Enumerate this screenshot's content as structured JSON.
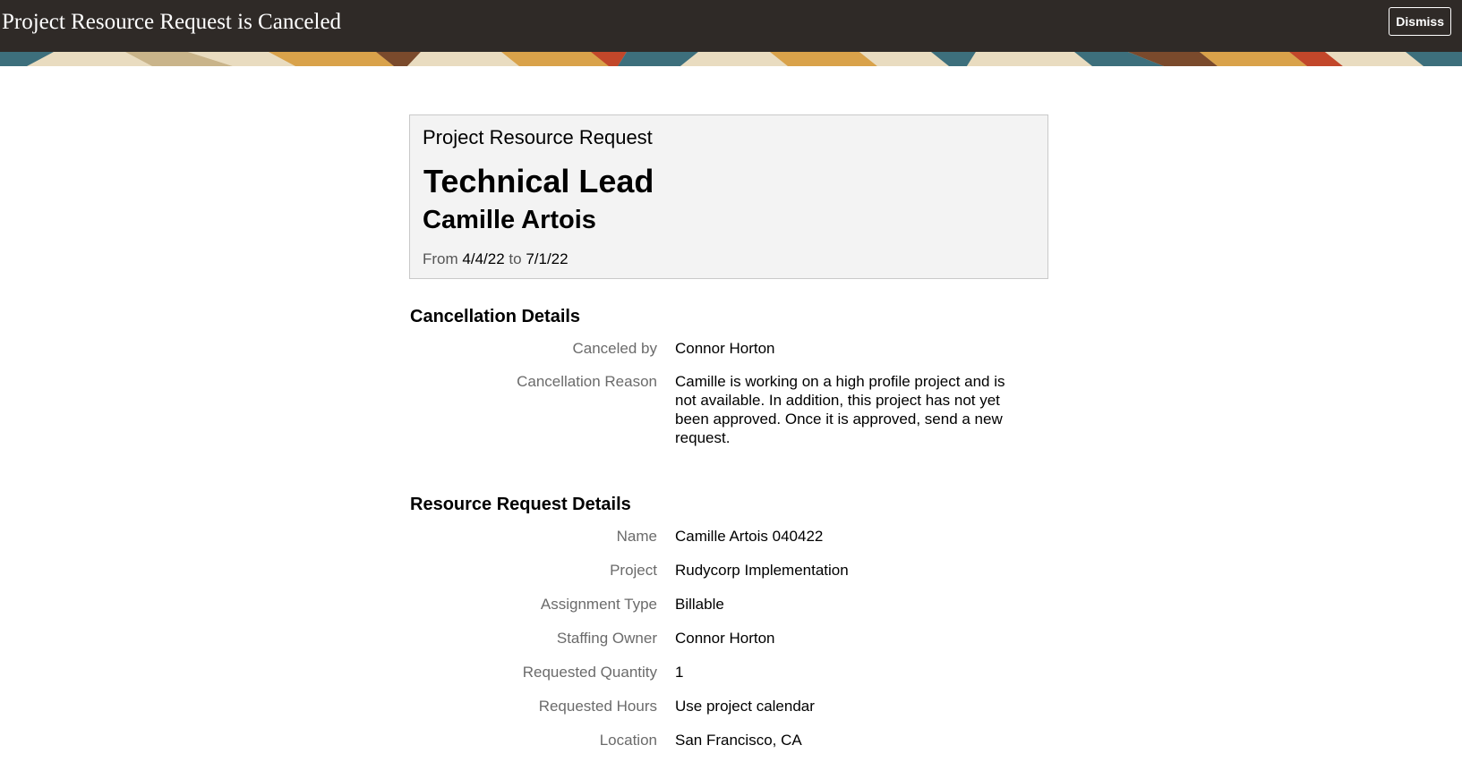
{
  "header": {
    "title": "Project Resource Request is Canceled",
    "dismiss_label": "Dismiss"
  },
  "colors": {
    "header_bg": "#2f2a27",
    "card_bg": "#f3f3f3",
    "label_text": "#6b6b6b",
    "banner_colors": [
      "#3d6f7c",
      "#d9a24a",
      "#c2472a",
      "#e9dcc0",
      "#7a4a2c"
    ]
  },
  "summary_card": {
    "heading": "Project Resource Request",
    "role": "Technical Lead",
    "person": "Camille Artois",
    "from_label": "From",
    "start_date": "4/4/22",
    "to_label": "to",
    "end_date": "7/1/22"
  },
  "cancellation": {
    "title": "Cancellation Details",
    "fields": [
      {
        "label": "Canceled by",
        "value": "Connor Horton"
      },
      {
        "label": "Cancellation Reason",
        "value": "Camille is working on a high profile project and is not available. In addition, this project has not yet been approved. Once it is approved, send a new request."
      }
    ]
  },
  "request_details": {
    "title": "Resource Request Details",
    "fields": [
      {
        "label": "Name",
        "value": "Camille Artois 040422"
      },
      {
        "label": "Project",
        "value": "Rudycorp Implementation"
      },
      {
        "label": "Assignment Type",
        "value": "Billable"
      },
      {
        "label": "Staffing Owner",
        "value": "Connor Horton"
      },
      {
        "label": "Requested Quantity",
        "value": "1"
      },
      {
        "label": "Requested Hours",
        "value": "Use project calendar"
      },
      {
        "label": "Location",
        "value": "San Francisco, CA"
      }
    ]
  }
}
